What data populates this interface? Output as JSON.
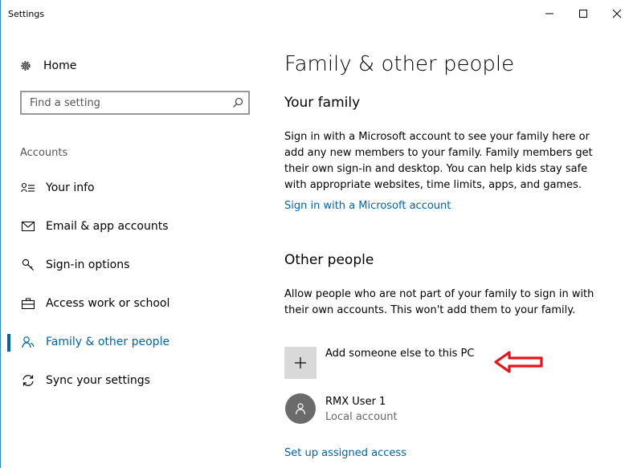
{
  "window": {
    "title": "Settings",
    "accent_color": "#0063b1",
    "controls": [
      "minimize-icon",
      "maximize-icon",
      "close-icon"
    ]
  },
  "sidebar": {
    "home_label": "Home",
    "search_placeholder": "Find a setting",
    "section_label": "Accounts",
    "items": [
      {
        "label": "Your info",
        "icon": "person-list-icon",
        "active": false
      },
      {
        "label": "Email & app accounts",
        "icon": "mail-icon",
        "active": false
      },
      {
        "label": "Sign-in options",
        "icon": "key-icon",
        "active": false
      },
      {
        "label": "Access work or school",
        "icon": "briefcase-icon",
        "active": false
      },
      {
        "label": "Family & other people",
        "icon": "people-icon",
        "active": true
      },
      {
        "label": "Sync your settings",
        "icon": "sync-icon",
        "active": false
      }
    ]
  },
  "main": {
    "title": "Family & other people",
    "family": {
      "heading": "Your family",
      "description": "Sign in with a Microsoft account to see your family here or add any new members to your family. Family members get their own sign-in and desktop. You can help kids stay safe with appropriate websites, time limits, apps, and games.",
      "link": "Sign in with a Microsoft account"
    },
    "other": {
      "heading": "Other people",
      "description": "Allow people who are not part of your family to sign in with their own accounts. This won't add them to your family.",
      "add_label": "Add someone else to this PC",
      "user": {
        "name": "RMX User 1",
        "type": "Local account"
      },
      "link": "Set up assigned access"
    }
  }
}
